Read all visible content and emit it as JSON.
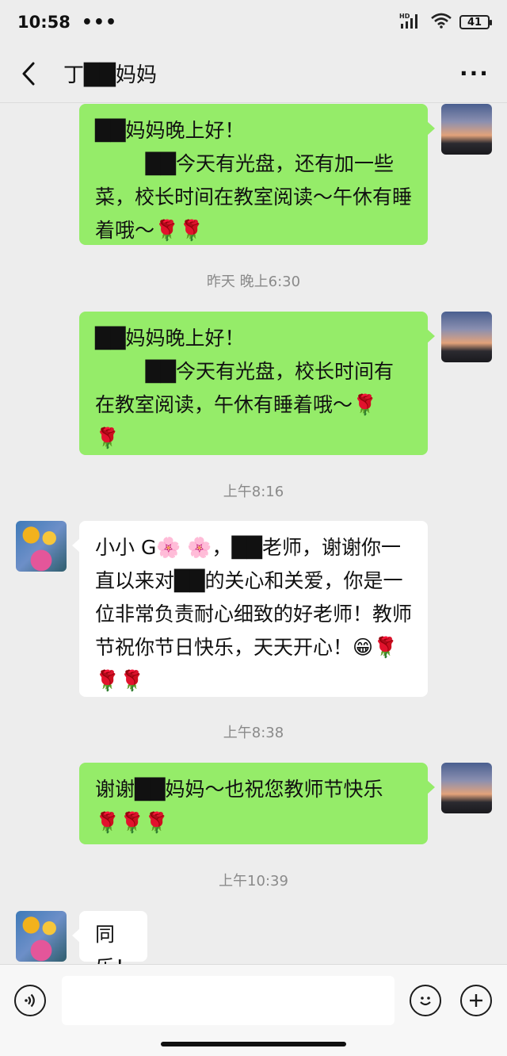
{
  "status_bar": {
    "time": "10:58",
    "dots": "•••",
    "hd_label": "HD",
    "battery": "41"
  },
  "header": {
    "title": "丁██妈妈",
    "back_icon": "chevron-left-icon",
    "more_icon": "more-horizontal-icon"
  },
  "messages": [
    {
      "side": "me",
      "text": "██妈妈晚上好！\n        ██今天有光盘，还有加一些菜，校长时间在教室阅读～午休有睡着哦～🌹🌹"
    },
    {
      "timestamp": "昨天 晚上6:30"
    },
    {
      "side": "me",
      "text": "██妈妈晚上好！\n        ██今天有光盘，校长时间有在教室阅读，午休有睡着哦～🌹\n🌹"
    },
    {
      "timestamp": "上午8:16"
    },
    {
      "side": "them",
      "text": "小小 G🌸 🌸，██老师，谢谢你一直以来对██的关心和关爱，你是一位非常负责耐心细致的好老师！教师节祝你节日快乐，天天开心！😁🌹🌹🌹"
    },
    {
      "timestamp": "上午8:38"
    },
    {
      "side": "me",
      "text": "谢谢██妈妈～也祝您教师节快乐\n🌹🌹🌹"
    },
    {
      "timestamp": "上午10:39"
    },
    {
      "side": "them",
      "text": "同乐！"
    }
  ],
  "input_bar": {
    "voice_icon": "voice-icon",
    "emoji_icon": "emoji-icon",
    "plus_icon": "plus-icon",
    "field_value": ""
  }
}
